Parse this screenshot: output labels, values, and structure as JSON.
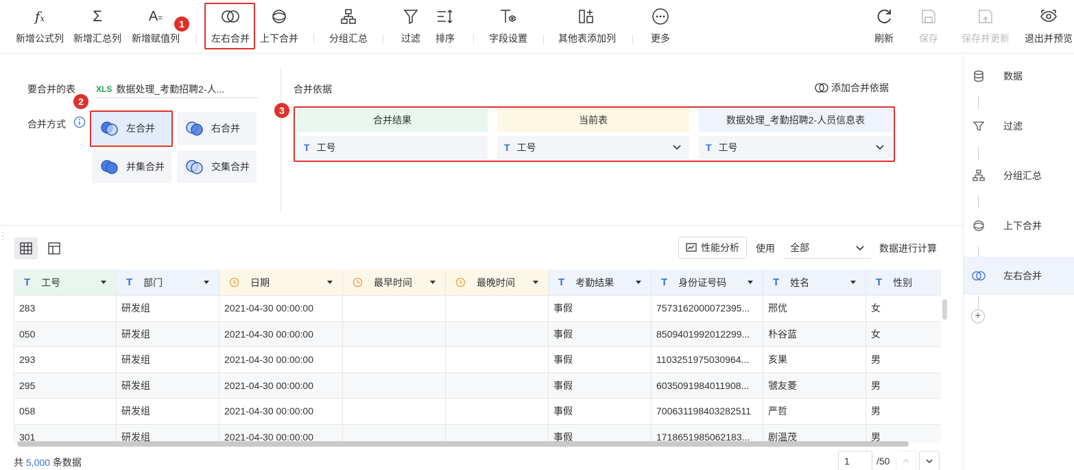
{
  "toolbar": {
    "items": [
      {
        "label": "新增公式列",
        "icon": "formula-icon"
      },
      {
        "label": "新增汇总列",
        "icon": "sigma-icon"
      },
      {
        "label": "新增赋值列",
        "icon": "assign-icon"
      },
      {
        "label": "左右合并",
        "icon": "left-right-merge-icon"
      },
      {
        "label": "上下合并",
        "icon": "up-down-merge-icon"
      },
      {
        "label": "分组汇总",
        "icon": "group-summary-icon"
      },
      {
        "label": "过滤",
        "icon": "filter-icon"
      },
      {
        "label": "排序",
        "icon": "sort-icon"
      },
      {
        "label": "字段设置",
        "icon": "field-settings-icon"
      },
      {
        "label": "其他表添加列",
        "icon": "add-column-icon"
      },
      {
        "label": "更多",
        "icon": "more-icon"
      }
    ],
    "right": [
      {
        "label": "刷新",
        "icon": "refresh-icon",
        "disabled": false
      },
      {
        "label": "保存",
        "icon": "save-icon",
        "disabled": true
      },
      {
        "label": "保存并更新",
        "icon": "save-update-icon",
        "disabled": true
      },
      {
        "label": "退出并预览",
        "icon": "preview-icon",
        "disabled": false
      }
    ]
  },
  "badges": [
    "1",
    "2",
    "3"
  ],
  "config": {
    "table_label": "要合并的表",
    "table_icon_text": "XLS",
    "table_name": "数据处理_考勤招聘2-人...",
    "method_label": "合并方式",
    "methods": [
      "左合并",
      "右合并",
      "并集合并",
      "交集合并"
    ],
    "basis_label": "合并依据",
    "add_basis": "添加合并依据",
    "basis_headers": [
      "合并结果",
      "当前表",
      "数据处理_考勤招聘2-人员信息表"
    ],
    "basis_fields": [
      "工号",
      "工号",
      "工号"
    ],
    "field_type_icon": "T"
  },
  "sidebar": {
    "steps": [
      {
        "label": "数据",
        "icon": "database-icon"
      },
      {
        "label": "过滤",
        "icon": "filter-icon"
      },
      {
        "label": "分组汇总",
        "icon": "group-summary-icon"
      },
      {
        "label": "上下合并",
        "icon": "up-down-merge-icon"
      },
      {
        "label": "左右合并",
        "icon": "left-right-merge-icon"
      }
    ],
    "add": "+"
  },
  "data_bar": {
    "perf_label": "性能分析",
    "use_label": "使用",
    "use_value": "全部",
    "calc_label": "数据进行计算"
  },
  "table": {
    "columns": [
      {
        "label": "工号",
        "type": "text"
      },
      {
        "label": "部门",
        "type": "text"
      },
      {
        "label": "日期",
        "type": "date"
      },
      {
        "label": "最早时间",
        "type": "date"
      },
      {
        "label": "最晚时间",
        "type": "date"
      },
      {
        "label": "考勤结果",
        "type": "text"
      },
      {
        "label": "身份证号码",
        "type": "text"
      },
      {
        "label": "姓名",
        "type": "text"
      },
      {
        "label": "性别",
        "type": "text"
      }
    ],
    "rows": [
      [
        "283",
        "研发组",
        "2021-04-30 00:00:00",
        "",
        "",
        "事假",
        "7573162000072395...",
        "邢优",
        "女"
      ],
      [
        "050",
        "研发组",
        "2021-04-30 00:00:00",
        "",
        "",
        "事假",
        "8509401992012299...",
        "朴谷蓝",
        "女"
      ],
      [
        "293",
        "研发组",
        "2021-04-30 00:00:00",
        "",
        "",
        "事假",
        "1103251975030964...",
        "亥果",
        "男"
      ],
      [
        "295",
        "研发组",
        "2021-04-30 00:00:00",
        "",
        "",
        "事假",
        "6035091984011908...",
        "虢友菱",
        "男"
      ],
      [
        "058",
        "研发组",
        "2021-04-30 00:00:00",
        "",
        "",
        "事假",
        "700631198403282511",
        "严哲",
        "男"
      ],
      [
        "301",
        "研发组",
        "2021-04-30 00:00:00",
        "",
        "",
        "事假",
        "1718651985062183...",
        "剧温茂",
        "男"
      ]
    ]
  },
  "footer": {
    "prefix": "共",
    "count": "5,000",
    "suffix": "条数据",
    "page": "1",
    "total": "/50"
  }
}
